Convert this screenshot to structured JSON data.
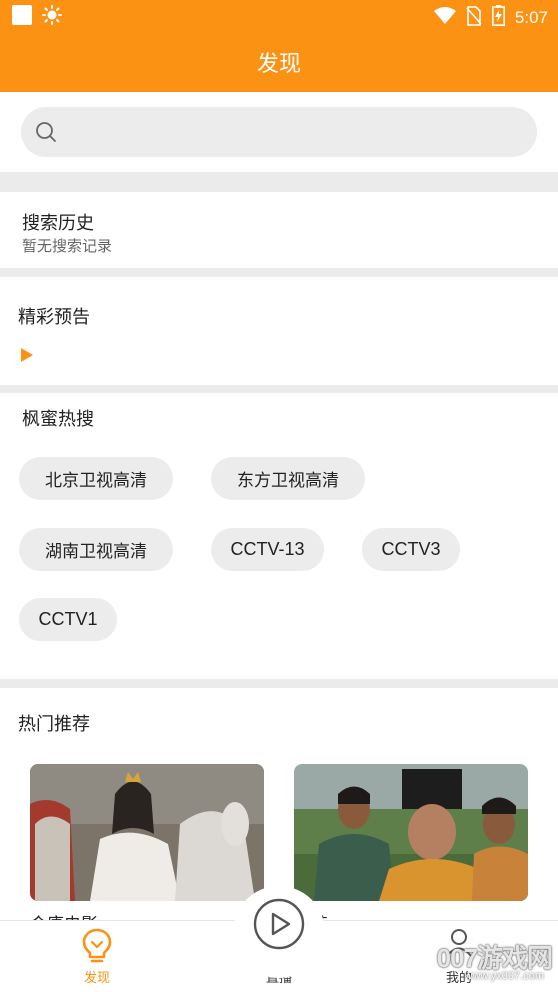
{
  "status_bar": {
    "time": "5:07"
  },
  "header": {
    "title": "发现"
  },
  "search": {
    "placeholder": ""
  },
  "history": {
    "title": "搜索历史",
    "empty_text": "暂无搜索记录"
  },
  "preview": {
    "title": "精彩预告"
  },
  "hot_search": {
    "title": "枫蜜热搜",
    "tags": [
      "北京卫视高清",
      "东方卫视高清",
      "湖南卫视高清",
      "CCTV-13",
      "CCTV3",
      "CCTV1"
    ]
  },
  "recommend": {
    "title": "热门推荐",
    "items": [
      {
        "caption": "金庸电影"
      },
      {
        "caption": "正英"
      }
    ]
  },
  "tabs": [
    {
      "label": "发现",
      "icon": "bulb-icon",
      "active": true
    },
    {
      "label": "直播",
      "icon": "play-circle-icon",
      "active": false
    },
    {
      "label": "我的",
      "icon": "person-icon",
      "active": false
    }
  ],
  "watermark": {
    "brand": "007游戏网",
    "url": "www.yx007.com"
  },
  "colors": {
    "accent": "#fb9213",
    "background": "#ebebeb",
    "chip": "#ececec"
  }
}
